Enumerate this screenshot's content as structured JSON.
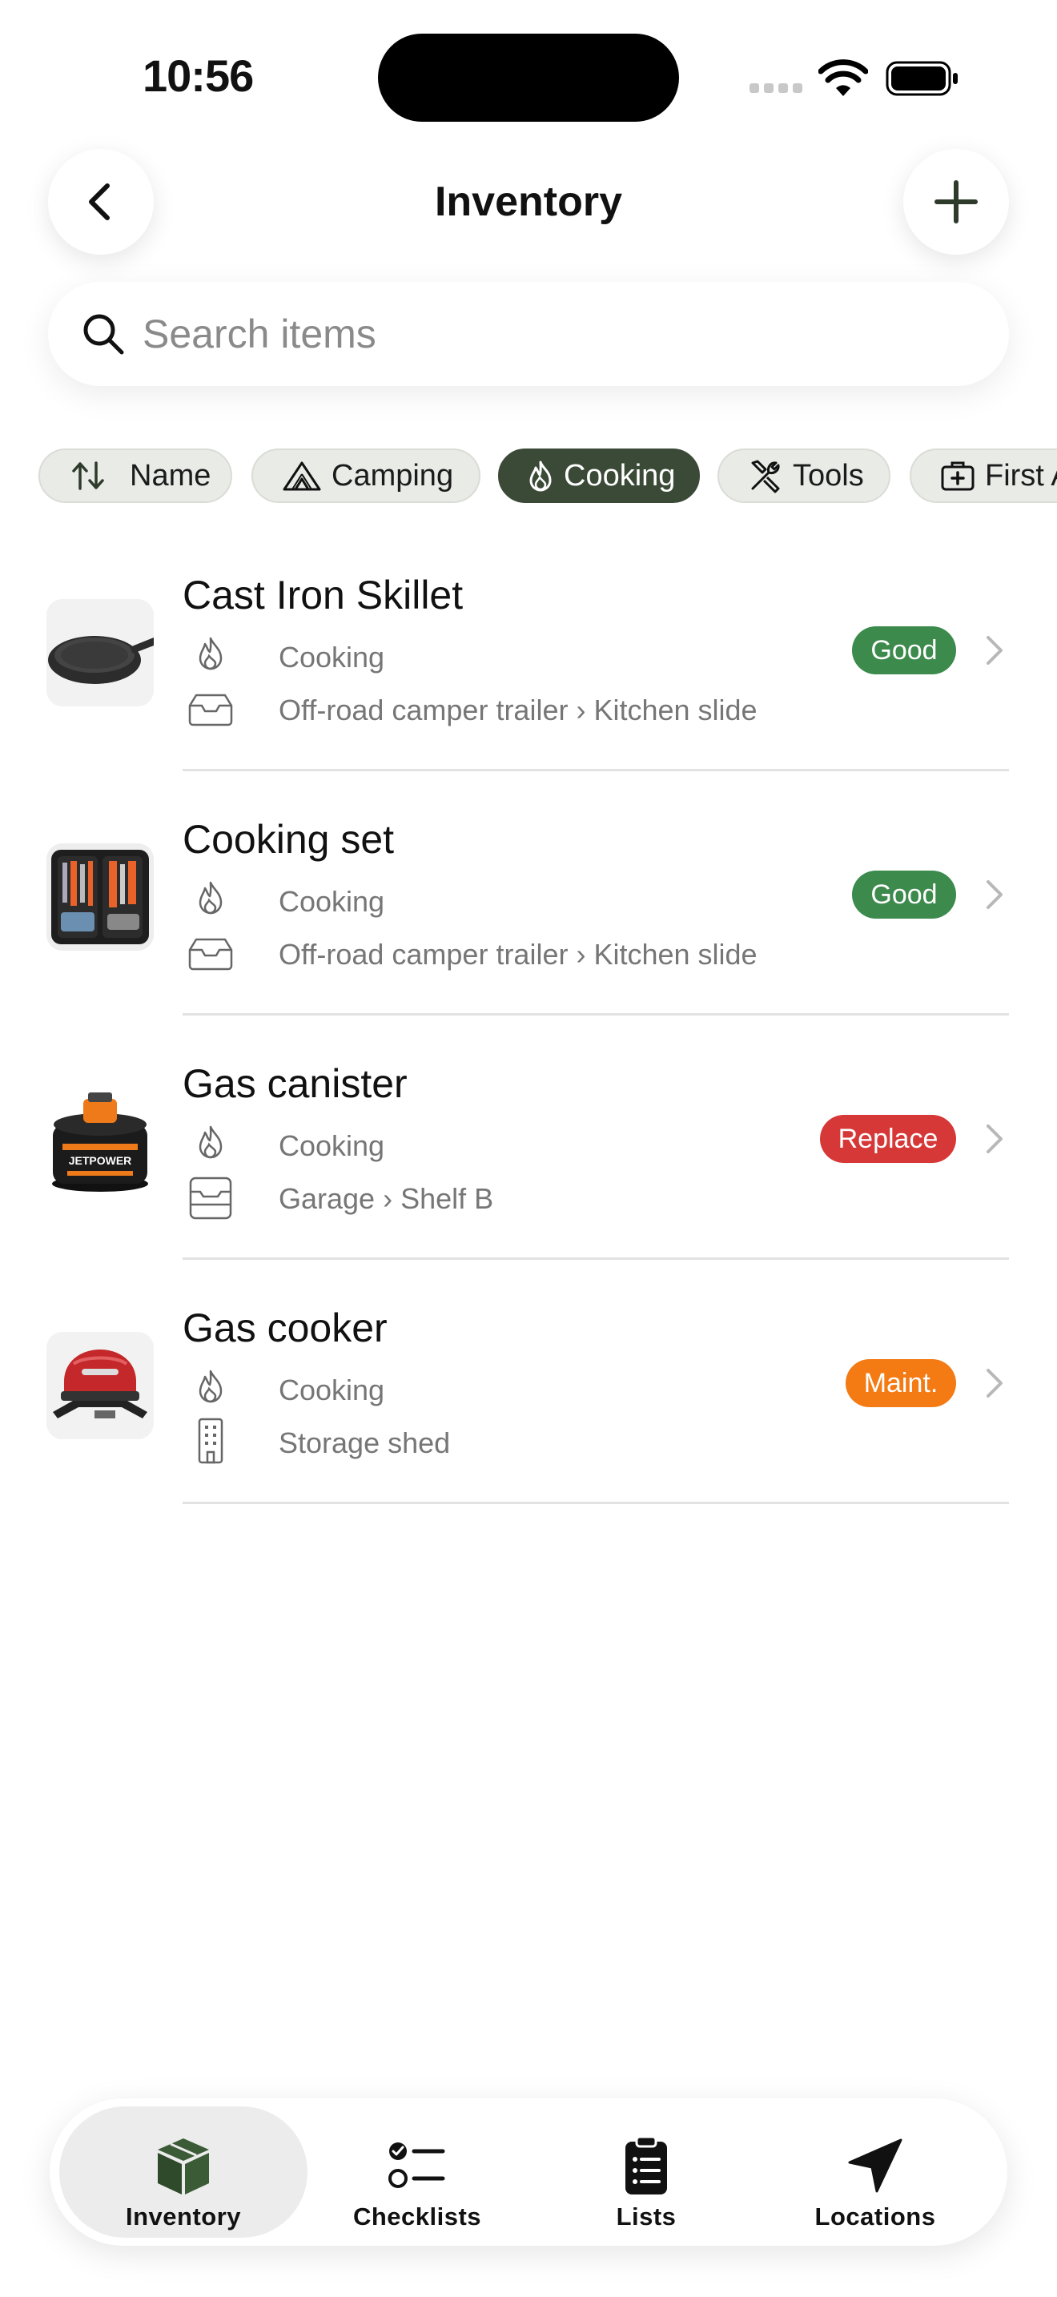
{
  "status_bar": {
    "time": "10:56"
  },
  "header": {
    "title": "Inventory"
  },
  "search": {
    "placeholder": "Search items",
    "value": ""
  },
  "filters": [
    {
      "label": "Name",
      "icon": "sort-icon",
      "active": false
    },
    {
      "label": "Camping",
      "icon": "tent-icon",
      "active": false
    },
    {
      "label": "Cooking",
      "icon": "flame-icon",
      "active": true
    },
    {
      "label": "Tools",
      "icon": "tools-icon",
      "active": false
    },
    {
      "label": "First Aid",
      "icon": "first-aid-icon",
      "active": false
    }
  ],
  "items": [
    {
      "name": "Cast Iron Skillet",
      "category": "Cooking",
      "location": "Off-road camper trailer › Kitchen slide",
      "location_icon": "tray-icon",
      "status": "Good",
      "status_color": "#3c8a4c",
      "thumb": "skillet"
    },
    {
      "name": "Cooking set",
      "category": "Cooking",
      "location": "Off-road camper trailer › Kitchen slide",
      "location_icon": "tray-icon",
      "status": "Good",
      "status_color": "#3c8a4c",
      "thumb": "utensil-case"
    },
    {
      "name": "Gas canister",
      "category": "Cooking",
      "location": "Garage › Shelf B",
      "location_icon": "cabinet-icon",
      "status": "Replace",
      "status_color": "#d63838",
      "thumb": "gas-canister"
    },
    {
      "name": "Gas cooker",
      "category": "Cooking",
      "location": "Storage shed",
      "location_icon": "building-icon",
      "status": "Maint.",
      "status_color": "#f47a13",
      "thumb": "grill"
    }
  ],
  "tabbar": [
    {
      "label": "Inventory",
      "icon": "box-icon",
      "active": true
    },
    {
      "label": "Checklists",
      "icon": "checklist-icon",
      "active": false
    },
    {
      "label": "Lists",
      "icon": "clipboard-icon",
      "active": false
    },
    {
      "label": "Locations",
      "icon": "location-arrow-icon",
      "active": false
    }
  ]
}
